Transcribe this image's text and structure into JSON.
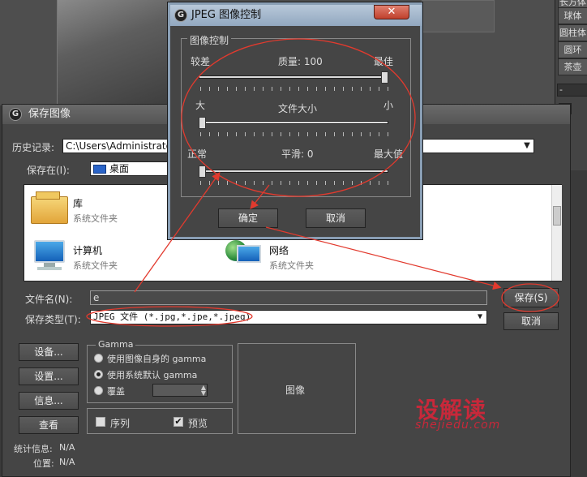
{
  "right_panel": {
    "items": [
      "长方体",
      "球体",
      "圆柱体",
      "圆环",
      "茶壶"
    ],
    "field": "-",
    "close": "✕"
  },
  "save_dialog": {
    "title": "保存图像",
    "history_label": "历史记录:",
    "history_value": "C:\\Users\\Administrator\\De",
    "save_in_label": "保存在(I):",
    "save_in_value": "桌面",
    "files": [
      {
        "name": "库",
        "sub": "系统文件夹"
      },
      {
        "name": "计算机",
        "sub": "系统文件夹"
      },
      {
        "name": "网络",
        "sub": "系统文件夹"
      }
    ],
    "filename_label": "文件名(N):",
    "filename_value": "e",
    "filetype_label": "保存类型(T):",
    "filetype_value": "JPEG 文件 (*.jpg,*.jpe,*.jpeg)",
    "save_button": "保存(S)",
    "cancel_button": "取消",
    "setup_button": "设备...",
    "settings_button": "设置...",
    "info_button": "信息...",
    "view_button": "查看",
    "gamma_label": "Gamma",
    "gamma_own": "使用图像自身的 gamma",
    "gamma_system": "使用系统默认 gamma",
    "gamma_override": "覆盖",
    "sequence_label": "序列",
    "preview_label": "预览",
    "image_label": "图像",
    "stats_label": "统计信息:",
    "stats_value": "N/A",
    "location_label": "位置:",
    "location_value": "N/A"
  },
  "jpeg_dialog": {
    "title": "JPEG 图像控制",
    "group_label": "图像控制",
    "quality": {
      "left": "较差",
      "center": "质量:",
      "value": "100",
      "right": "最佳",
      "level": 1.0
    },
    "filesize": {
      "left": "大",
      "center": "文件大小",
      "right": "小",
      "level": 0.0
    },
    "smoothing": {
      "left": "正常",
      "center": "平滑:",
      "value": "0",
      "right": "最大值",
      "level": 0.0
    },
    "ok_button": "确定",
    "cancel_button": "取消",
    "close": "✕"
  },
  "watermark": {
    "title": "设解读",
    "url": "shejiedu.com"
  },
  "colors": {
    "annotation": "#e23a2e",
    "watermark": "#c8283a"
  }
}
